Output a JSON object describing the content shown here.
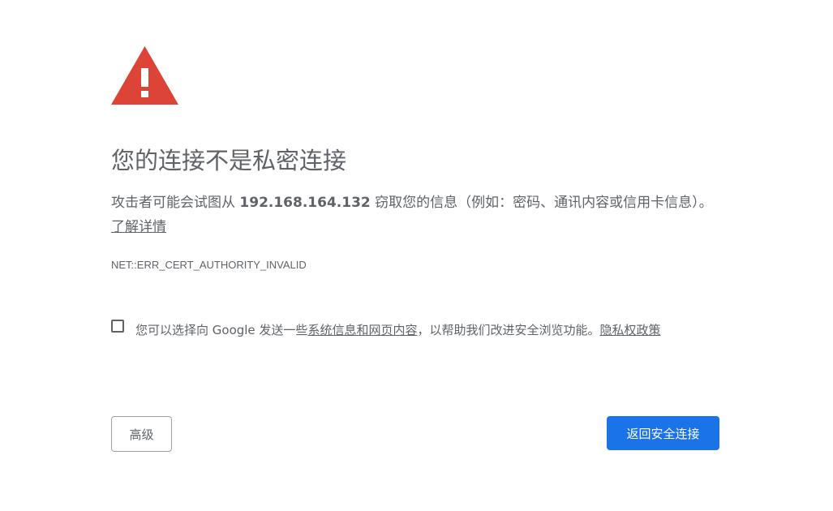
{
  "icon": {
    "name": "warning-triangle-icon",
    "color": "#db4437",
    "glyph": "!"
  },
  "title": "您的连接不是私密连接",
  "description": {
    "prefix": "攻击者可能会试图从 ",
    "host": "192.168.164.132",
    "suffix": " 窃取您的信息（例如：密码、通讯内容或信用卡信息）。",
    "learn_more": "了解详情"
  },
  "error_code": "NET::ERR_CERT_AUTHORITY_INVALID",
  "optin": {
    "checked": false,
    "text_1": "您可以选择向 Google 发送一些",
    "link_system_info": "系统信息和网页内容",
    "text_2": "，以帮助我们改进安全浏览功能。",
    "link_privacy": "隐私权政策"
  },
  "buttons": {
    "advanced": "高级",
    "back_to_safety": "返回安全连接"
  },
  "colors": {
    "text": "#5f6368",
    "primary_button": "#1a73e8",
    "warning": "#db4437"
  }
}
